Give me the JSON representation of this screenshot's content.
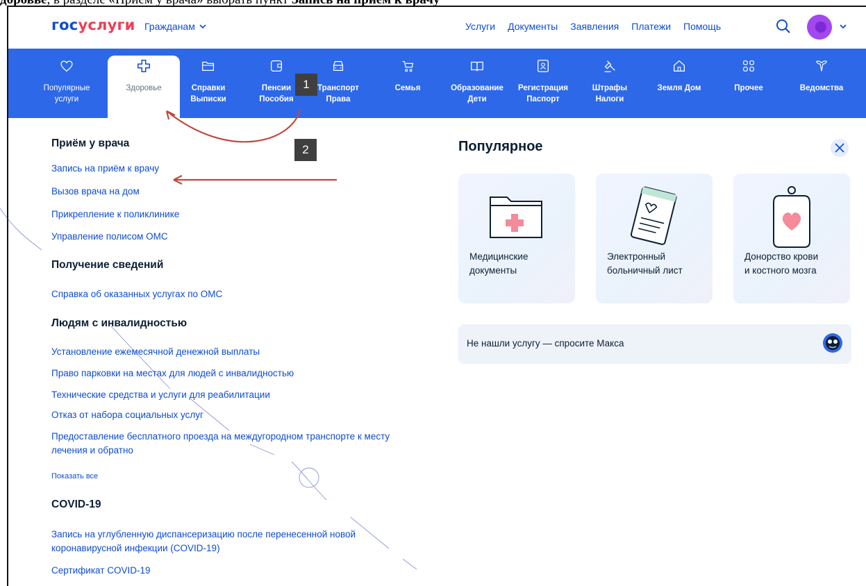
{
  "document_top_text": {
    "prefix_bold": "доровье",
    "middle": ", в разделе «Приём у врача» выбрать пункт ",
    "suffix_bold": "Запись на приём к врачу"
  },
  "header": {
    "logo_part1": "гос",
    "logo_part2": "услуги",
    "audience_menu": "Гражданам",
    "nav": [
      "Услуги",
      "Документы",
      "Заявления",
      "Платежи",
      "Помощь"
    ]
  },
  "categories": [
    {
      "label": "Популярные\nуслуги",
      "icon": "heart-icon"
    },
    {
      "label": "Здоровье",
      "icon": "medical-cross-icon",
      "active": true
    },
    {
      "label": "Справки\nВыписки",
      "icon": "folder-icon"
    },
    {
      "label": "Пенсии\nПособия",
      "icon": "wallet-icon"
    },
    {
      "label": "Транспорт\nПрава",
      "icon": "car-icon"
    },
    {
      "label": "Семья",
      "icon": "stroller-icon"
    },
    {
      "label": "Образование\nДети",
      "icon": "book-icon"
    },
    {
      "label": "Регистрация\nПаспорт",
      "icon": "passport-icon"
    },
    {
      "label": "Штрафы\nНалоги",
      "icon": "gavel-icon"
    },
    {
      "label": "Земля Дом",
      "icon": "house-icon"
    },
    {
      "label": "Прочее",
      "icon": "grid-icon"
    },
    {
      "label": "Ведомства",
      "icon": "emblem-icon"
    }
  ],
  "sections": {
    "doctor": {
      "title": "Приём у врача",
      "links": [
        "Запись на приём к врачу",
        "Вызов врача на дом",
        "Прикрепление к поликлинике",
        "Управление полисом ОМС"
      ]
    },
    "info": {
      "title": "Получение сведений",
      "links": [
        "Справка об оказанных услугах по ОМС"
      ]
    },
    "disability": {
      "title": "Людям с инвалидностью",
      "links": [
        "Установление ежемесячной денежной выплаты",
        "Право парковки на местах для людей с инвалидностью",
        "Технические средства и услуги для реабилитации",
        "Отказ от набора социальных услуг",
        "Предоставление бесплатного проезда на междугородном транспорте к месту лечения и обратно"
      ],
      "show_all": "Показать все"
    },
    "covid": {
      "title": "COVID-19",
      "links": [
        "Запись на углубленную диспансеризацию после перенесенной новой коронавирусной инфекции (COVID-19)",
        "Сертификат COVID-19"
      ]
    }
  },
  "popular": {
    "title": "Популярное",
    "cards": [
      {
        "label": "Медицинские\nдокументы",
        "icon": "medical-folder-icon"
      },
      {
        "label": "Электронный\nбольничный лист",
        "icon": "sick-leave-icon"
      },
      {
        "label": "Донорство крови\nи костного мозга",
        "icon": "blood-bag-icon"
      }
    ],
    "ask_text": "Не нашли услугу — спросите Макса",
    "ask_icon": "robot-assistant-icon"
  },
  "annotations": {
    "step1": "1",
    "step2": "2",
    "arrow_color": "#c0483e"
  },
  "colors": {
    "brand_blue": "#0d4cd3",
    "catbar": "#2d68e8",
    "brand_red": "#ee3f58"
  }
}
